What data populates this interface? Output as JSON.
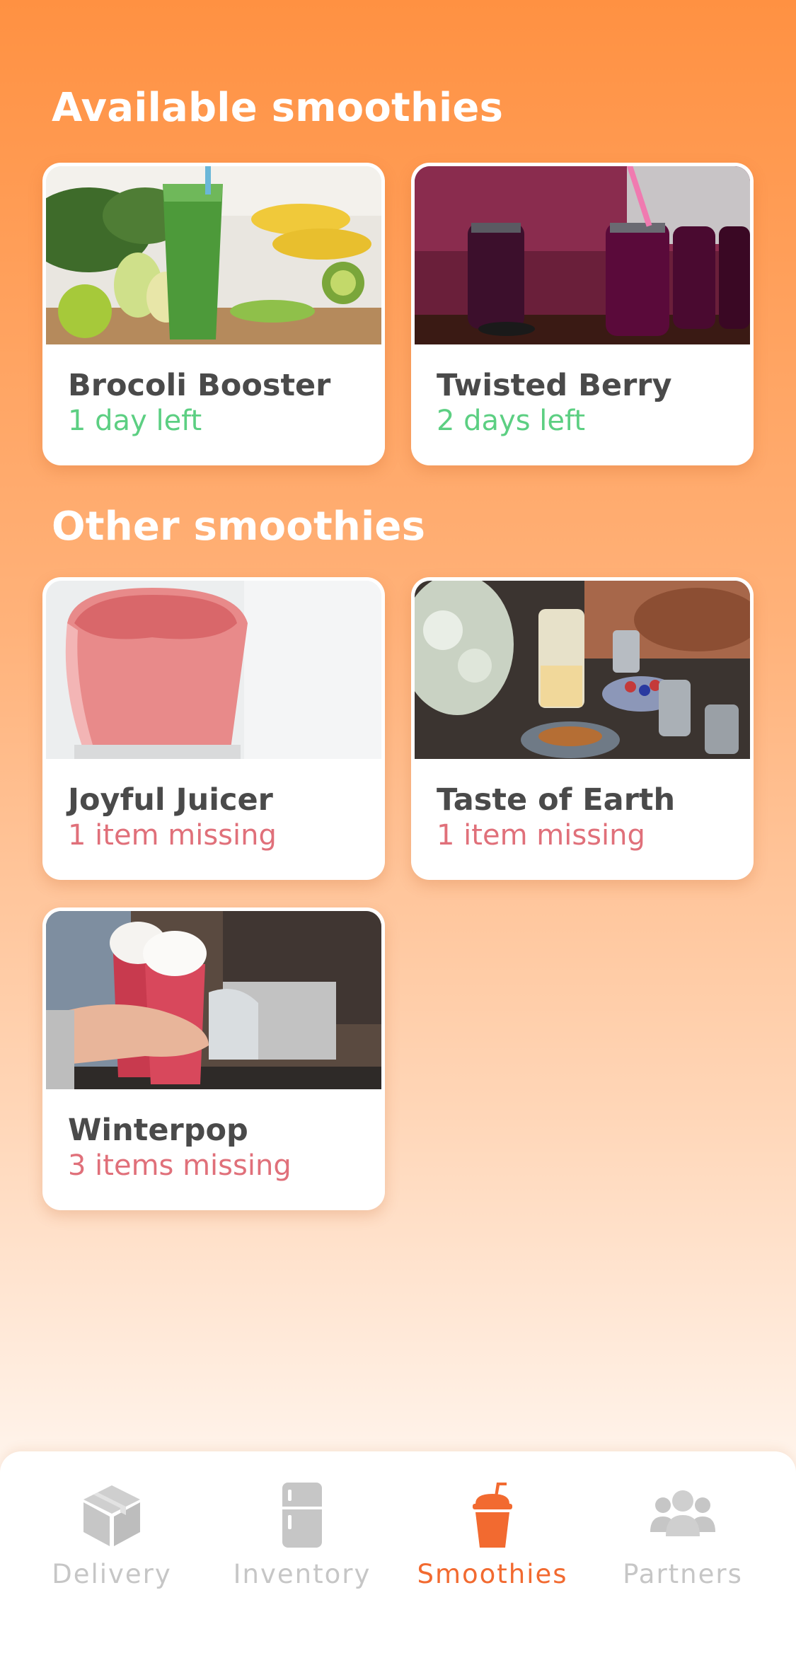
{
  "sections": {
    "available_title": "Available smoothies",
    "other_title": "Other smoothies"
  },
  "available": [
    {
      "name": "Brocoli Booster",
      "status": "1 day left"
    },
    {
      "name": "Twisted Berry",
      "status": "2 days left"
    }
  ],
  "other": [
    {
      "name": "Joyful Juicer",
      "status": "1 item missing"
    },
    {
      "name": "Taste of Earth",
      "status": "1 item missing"
    },
    {
      "name": "Winterpop",
      "status": "3 items missing"
    }
  ],
  "tabs": [
    {
      "label": "Delivery",
      "icon": "package-icon",
      "active": false
    },
    {
      "label": "Inventory",
      "icon": "fridge-icon",
      "active": false
    },
    {
      "label": "Smoothies",
      "icon": "smoothie-cup-icon",
      "active": true
    },
    {
      "label": "Partners",
      "icon": "people-icon",
      "active": false
    }
  ],
  "colors": {
    "accent": "#f26a30",
    "available_status": "#5ccf82",
    "missing_status": "#e0707a",
    "inactive_tab": "#c6c6c6"
  }
}
